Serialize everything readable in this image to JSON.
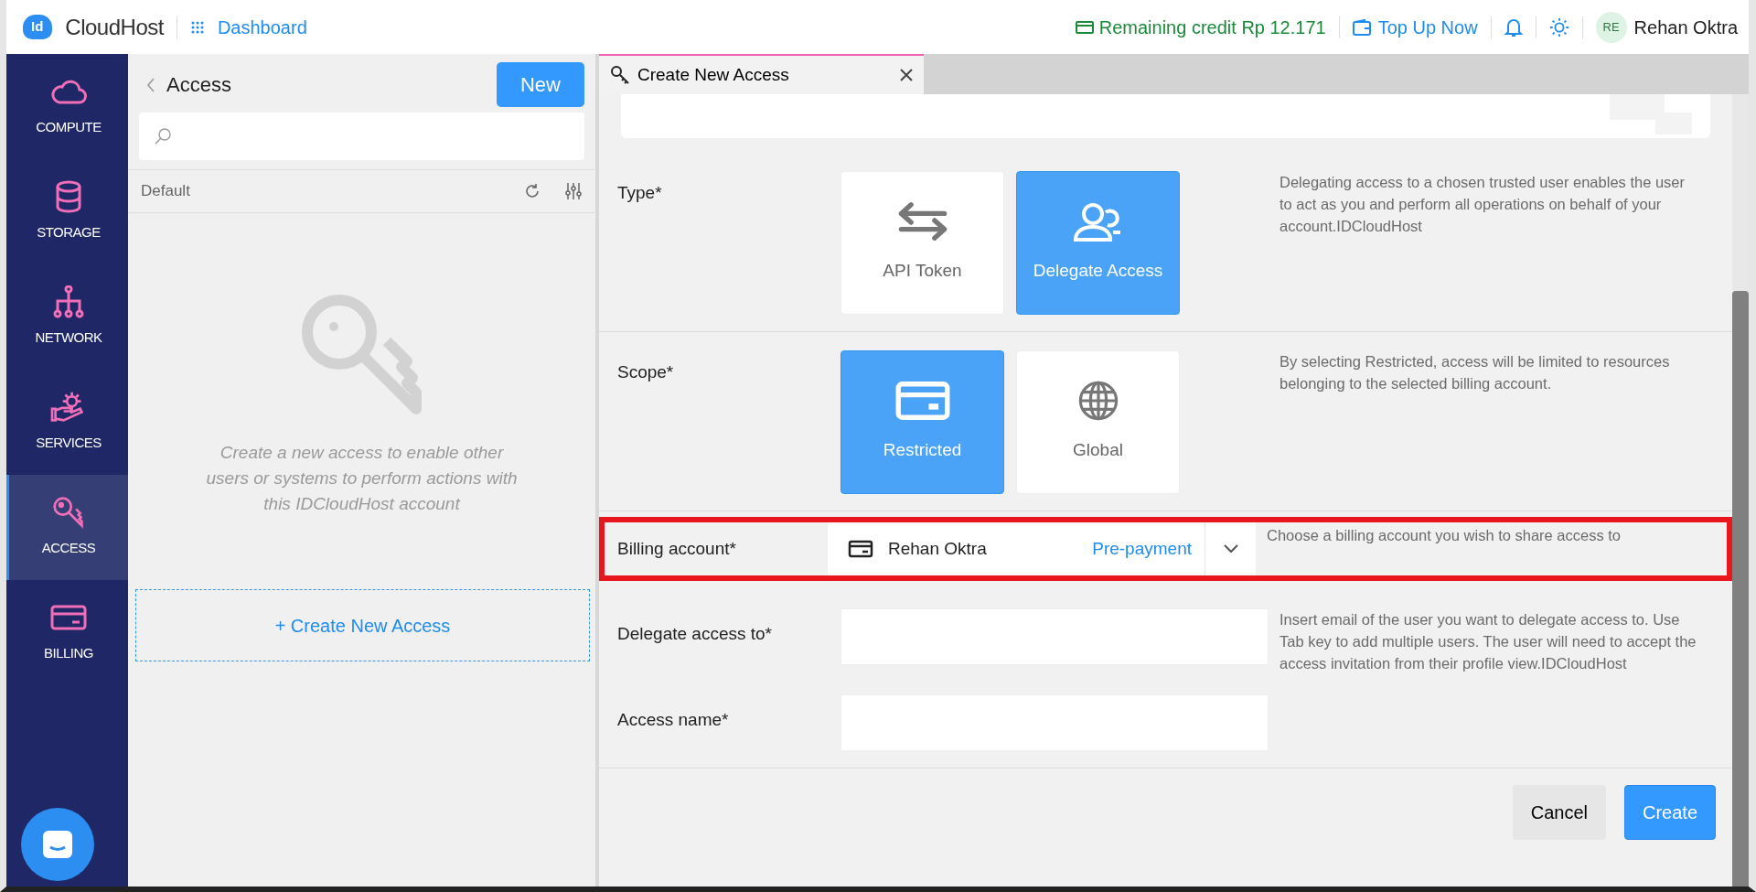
{
  "topbar": {
    "logo_mark": "Id",
    "logo_text": "CloudHost",
    "dashboard_link": "Dashboard",
    "credit": "Remaining credit Rp 12.171",
    "top_up": "Top Up Now",
    "avatar_initials": "RE",
    "user_name": "Rehan Oktra"
  },
  "sidebar": {
    "items": [
      {
        "label": "COMPUTE",
        "selected": false
      },
      {
        "label": "STORAGE",
        "selected": false
      },
      {
        "label": "NETWORK",
        "selected": false
      },
      {
        "label": "SERVICES",
        "selected": false
      },
      {
        "label": "ACCESS",
        "selected": true
      },
      {
        "label": "BILLING",
        "selected": false
      }
    ]
  },
  "list_panel": {
    "title": "Access",
    "new_button": "New",
    "group": "Default",
    "empty_text": "Create a new access to enable other users or systems to perform actions with this IDCloudHost account",
    "create_link": "+ Create New Access"
  },
  "tab": {
    "title": "Create New Access",
    "selected": true
  },
  "form": {
    "rows": [
      {
        "kind": "options",
        "label": "Type*",
        "help": "Delegating access to a chosen trusted user enables the user to act as you and perform all operations on behalf of your account.IDCloudHost",
        "options": [
          {
            "label": "API Token",
            "selected": false
          },
          {
            "label": "Delegate Access",
            "selected": true
          }
        ]
      },
      {
        "kind": "options",
        "label": "Scope*",
        "help": "By selecting Restricted, access will be limited to resources belonging to the selected billing account.",
        "options": [
          {
            "label": "Restricted",
            "selected": true
          },
          {
            "label": "Global",
            "selected": false
          }
        ]
      },
      {
        "kind": "select",
        "label": "Billing account*",
        "help": "Choose a billing account you wish to share access to",
        "value": "Rehan Oktra",
        "tag": "Pre-payment",
        "highlighted": true
      },
      {
        "kind": "input",
        "label": "Delegate access to*",
        "help": "Insert email of the user you want to delegate access to. Use Tab key to add multiple users. The user will need to accept the access invitation from their profile view.IDCloudHost"
      },
      {
        "kind": "input",
        "label": "Access name*"
      }
    ]
  },
  "footer": {
    "cancel": "Cancel",
    "create": "Create"
  }
}
